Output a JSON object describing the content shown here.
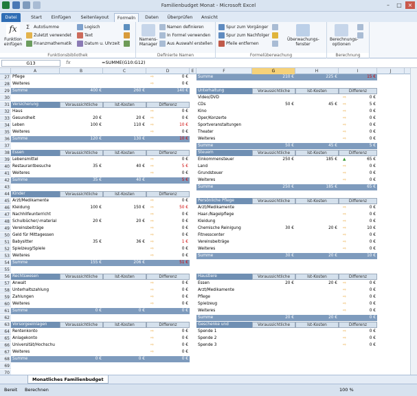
{
  "window": {
    "title": "Familienbudget Monat - Microsoft Excel",
    "min": "–",
    "max": "□",
    "close": "×"
  },
  "tabs": [
    "Datei",
    "Start",
    "Einfügen",
    "Seitenlayout",
    "Formeln",
    "Daten",
    "Überprüfen",
    "Ansicht"
  ],
  "ribbon": {
    "fn_insert": "Funktion einfügen",
    "autosum": "AutoSumme",
    "recent": "Zuletzt verwendet",
    "finance": "Finanzmathematik",
    "logical": "Logisch",
    "text": "Text",
    "datetime": "Datum u. Uhrzeit",
    "group_lib": "Funktionsbibliothek",
    "name_mgr": "Namens-Manager",
    "define": "Namen definieren",
    "in_formula": "In Formel verwenden",
    "from_sel": "Aus Auswahl erstellen",
    "group_names": "Definierte Namen",
    "trace_prec": "Spur zum Vorgänger",
    "trace_dep": "Spur zum Nachfolger",
    "remove_arrows": "Pfeile entfernen",
    "group_audit": "Formelüberwachung",
    "watch": "Überwachungs-fenster",
    "calc_opts": "Berechnungs-optionen",
    "group_calc": "Berechnung"
  },
  "formula_bar": {
    "cell": "G13",
    "fx": "fx",
    "formula": "=SUMME(G10:G12)"
  },
  "columns": [
    "A",
    "B",
    "C",
    "D",
    "E",
    "F",
    "G",
    "H",
    "I",
    "J"
  ],
  "left_blocks": [
    {
      "header": null,
      "rows": [
        [
          "Pflege",
          "",
          "",
          "0 €"
        ],
        [
          "Weiteres",
          "",
          "",
          "0 €"
        ]
      ],
      "sum": [
        "Summe",
        "400 €",
        "260 €",
        "140 €"
      ],
      "start": 27,
      "redsum": false
    },
    {
      "header": [
        "Versicherung",
        "Voraussichtliche",
        "Ist-Kosten",
        "Differenz"
      ],
      "rows": [
        [
          "Haus",
          "",
          "",
          "0 €"
        ],
        [
          "Gesundheit",
          "20 €",
          "20 €",
          "0 €"
        ],
        [
          "Leben",
          "100 €",
          "110 €",
          "10 €"
        ],
        [
          "Weiteres",
          "",
          "",
          "0 €"
        ]
      ],
      "sum": [
        "Summe",
        "120 €",
        "130 €",
        "10 €"
      ],
      "start": 31,
      "redsum": true
    },
    {
      "header": [
        "Essen",
        "Voraussichtliche",
        "Ist-Kosten",
        "Differenz"
      ],
      "rows": [
        [
          "Lebensmittel",
          "",
          "",
          "0 €"
        ],
        [
          "Restaurantbesuche",
          "35 €",
          "40 €",
          "5 €"
        ],
        [
          "Weiteres",
          "",
          "",
          "0 €"
        ]
      ],
      "sum": [
        "Summe",
        "35 €",
        "40 €",
        "5 €"
      ],
      "start": 38,
      "redsum": true
    },
    {
      "header": [
        "Kinder",
        "Voraussichtliche",
        "Ist-Kosten",
        "Differenz"
      ],
      "rows": [
        [
          "Arzt/Medikamente",
          "",
          "",
          "0 €"
        ],
        [
          "Kleidung",
          "100 €",
          "150 €",
          "50 €"
        ],
        [
          "Nachhilfeunterricht",
          "",
          "",
          "0 €"
        ],
        [
          "Schulbücher/-material",
          "20 €",
          "20 €",
          "0 €"
        ],
        [
          "Vereinsbeiträge",
          "",
          "",
          "0 €"
        ],
        [
          "Geld für Mittagessen",
          "",
          "",
          "0 €"
        ],
        [
          "Babysitter",
          "35 €",
          "36 €",
          "1 €"
        ],
        [
          "Spielzeug/Spiele",
          "",
          "",
          "0 €"
        ],
        [
          "Weiteres",
          "",
          "",
          "0 €"
        ]
      ],
      "sum": [
        "Summe",
        "155 €",
        "206 €",
        "51 €"
      ],
      "start": 44,
      "redsum": true
    },
    {
      "header": [
        "Rechtswesen",
        "Voraussichtliche",
        "Ist-Kosten",
        "Differenz"
      ],
      "rows": [
        [
          "Anwalt",
          "",
          "",
          "0 €"
        ],
        [
          "Unterhaltszahlung",
          "",
          "",
          "0 €"
        ],
        [
          "Zahlungen",
          "",
          "",
          "0 €"
        ],
        [
          "Weiteres",
          "",
          "",
          "0 €"
        ]
      ],
      "sum": [
        "Summe",
        "0 €",
        "0 €",
        "0 €"
      ],
      "start": 56,
      "redsum": false
    },
    {
      "header": [
        "Vorsorgeeinlagen",
        "Voraussichtliche",
        "Ist-Kosten",
        "Differenz"
      ],
      "rows": [
        [
          "Rentenkonto",
          "",
          "",
          "0 €"
        ],
        [
          "Anlagekonto",
          "",
          "",
          "0 €"
        ],
        [
          "Universität/Hochschu",
          "",
          "",
          "0 €"
        ],
        [
          "Weiteres",
          "",
          "",
          "0 €"
        ]
      ],
      "sum": [
        "Summe",
        "0 €",
        "0 €",
        "0 €"
      ],
      "start": 63,
      "redsum": false
    }
  ],
  "right_blocks": [
    {
      "header": null,
      "rows": [],
      "sum": [
        "Summe",
        "210 €",
        "225 €",
        "15 €"
      ],
      "start": 27,
      "redsum": true,
      "row_offset": 0
    },
    {
      "header": [
        "Unterhaltung",
        "Voraussichtliche",
        "Ist-Kosten",
        "Differenz"
      ],
      "rows": [
        [
          "Video/DVD",
          "",
          "",
          "0 €"
        ],
        [
          "CDs",
          "50 €",
          "45 €",
          "5 €"
        ],
        [
          "Kino",
          "",
          "",
          "0 €"
        ],
        [
          "Oper/Konzerte",
          "",
          "",
          "0 €"
        ],
        [
          "Sportveranstaltungen",
          "",
          "",
          "0 €"
        ],
        [
          "Theater",
          "",
          "",
          "0 €"
        ],
        [
          "Weiteres",
          "",
          "",
          "0 €"
        ]
      ],
      "sum": [
        "Summe",
        "50 €",
        "45 €",
        "5 €"
      ],
      "start": 29,
      "redsum": false
    },
    {
      "header": [
        "Steuern",
        "Voraussichtliche",
        "Ist-Kosten",
        "Differenz"
      ],
      "rows": [
        [
          "Einkommensteuer",
          "250 €",
          "185 €",
          "65 €"
        ],
        [
          "Land",
          "",
          "",
          "0 €"
        ],
        [
          "Grundsteuer",
          "",
          "",
          "0 €"
        ],
        [
          "Weiteres",
          "",
          "",
          "0 €"
        ]
      ],
      "sum": [
        "Summe",
        "250 €",
        "185 €",
        "65 €"
      ],
      "start": 38,
      "redsum": false,
      "up": 0
    },
    {
      "header": [
        "Persönliche Pflege",
        "Voraussichtliche",
        "Ist-Kosten",
        "Differenz"
      ],
      "rows": [
        [
          "Arzt/Medikamente",
          "",
          "",
          "0 €"
        ],
        [
          "Haar-/Nagelpflege",
          "",
          "",
          "0 €"
        ],
        [
          "Kleidung",
          "",
          "",
          "0 €"
        ],
        [
          "Chemische Reinigung",
          "30 €",
          "20 €",
          "10 €"
        ],
        [
          "Fitnesscenter",
          "",
          "",
          "0 €"
        ],
        [
          "Vereinsbeiträge",
          "",
          "",
          "0 €"
        ],
        [
          "Weiteres",
          "",
          "",
          "0 €"
        ]
      ],
      "sum": [
        "Summe",
        "30 €",
        "20 €",
        "10 €"
      ],
      "start": 45,
      "redsum": false
    },
    {
      "header": [
        "Haustiere",
        "Voraussichtliche",
        "Ist-Kosten",
        "Differenz"
      ],
      "rows": [
        [
          "Essen",
          "20 €",
          "20 €",
          "0 €"
        ],
        [
          "Arzt/Medikamente",
          "",
          "",
          "0 €"
        ],
        [
          "Pflege",
          "",
          "",
          "0 €"
        ],
        [
          "Spielzeug",
          "",
          "",
          "0 €"
        ],
        [
          "Weiteres",
          "",
          "",
          "0 €"
        ]
      ],
      "sum": [
        "Summe",
        "20 €",
        "20 €",
        "0 €"
      ],
      "start": 56,
      "redsum": false
    },
    {
      "header": [
        "Geschenke und",
        "Voraussichtliche",
        "Ist-Kosten",
        "Differenz"
      ],
      "rows": [
        [
          "Spende 1",
          "",
          "",
          "0 €"
        ],
        [
          "Spende 2",
          "",
          "",
          "0 €"
        ],
        [
          "Spende 3",
          "",
          "",
          "0 €"
        ]
      ],
      "sum": null,
      "start": 63,
      "redsum": false
    }
  ],
  "sheet_tab": "Monatliches Familienbudget",
  "status": {
    "ready": "Bereit",
    "calc": "Berechnen",
    "zoom": "100 %"
  }
}
